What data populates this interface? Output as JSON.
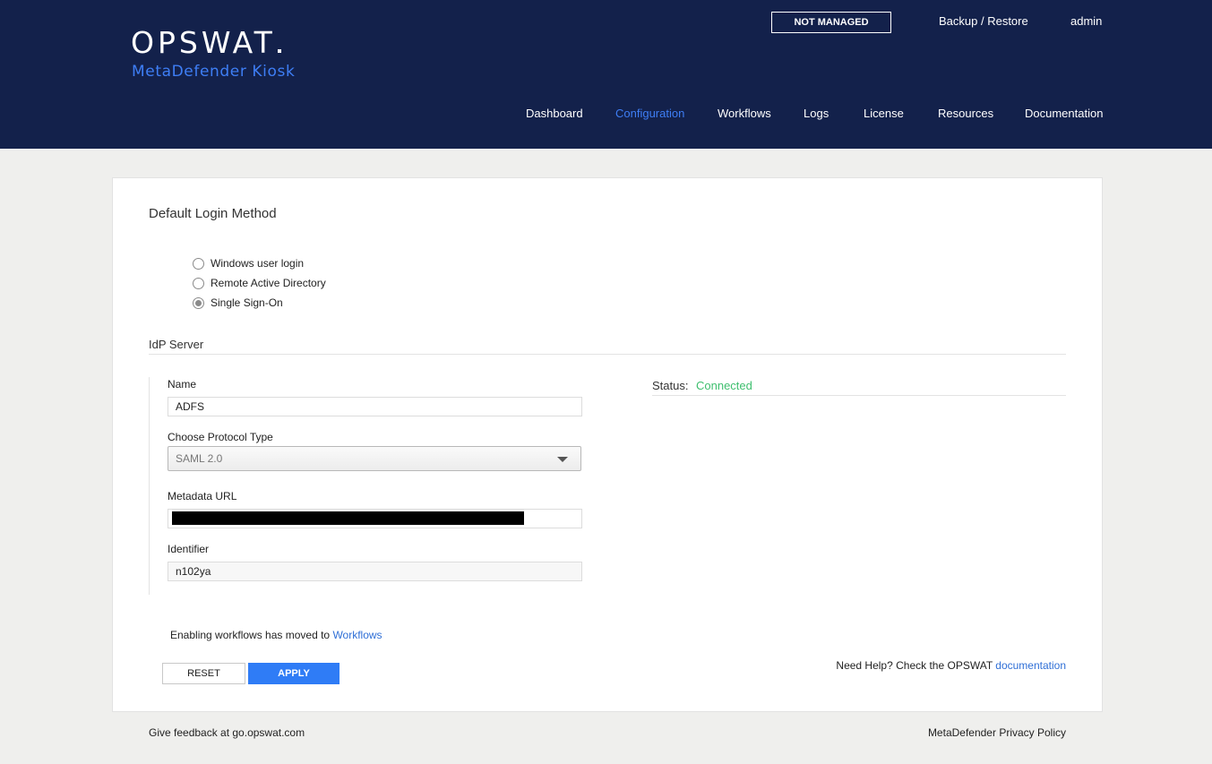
{
  "brand": {
    "logo": "OPSWAT",
    "product": "MetaDefender Kiosk"
  },
  "header": {
    "management_badge": "NOT MANAGED",
    "backup_restore": "Backup / Restore",
    "user": "admin"
  },
  "nav": {
    "items": [
      {
        "label": "Dashboard"
      },
      {
        "label": "Configuration"
      },
      {
        "label": "Workflows"
      },
      {
        "label": "Logs"
      },
      {
        "label": "License"
      },
      {
        "label": "Resources"
      },
      {
        "label": "Documentation"
      }
    ],
    "active": "Configuration"
  },
  "login_method": {
    "title": "Default Login Method",
    "options": [
      {
        "label": "Windows user login",
        "selected": false
      },
      {
        "label": "Remote Active Directory",
        "selected": false
      },
      {
        "label": "Single Sign-On",
        "selected": true
      }
    ]
  },
  "idp": {
    "title": "IdP Server",
    "name_label": "Name",
    "name_value": "ADFS",
    "protocol_label": "Choose Protocol Type",
    "protocol_value": "SAML 2.0",
    "metadata_label": "Metadata URL",
    "identifier_label": "Identifier",
    "identifier_value": "n102ya",
    "status_label": "Status:",
    "status_value": "Connected"
  },
  "notice": {
    "text": "Enabling workflows has moved to ",
    "link": "Workflows"
  },
  "actions": {
    "reset": "RESET",
    "apply": "APPLY"
  },
  "help": {
    "text": "Need Help? Check the OPSWAT ",
    "link": "documentation"
  },
  "footer": {
    "feedback": "Give feedback at go.opswat.com",
    "privacy": "MetaDefender Privacy Policy"
  },
  "colors": {
    "header_bg": "#13214b",
    "accent": "#3e7ef5",
    "status_connected": "#3fbf6f",
    "apply_button": "#2f7cf6"
  }
}
